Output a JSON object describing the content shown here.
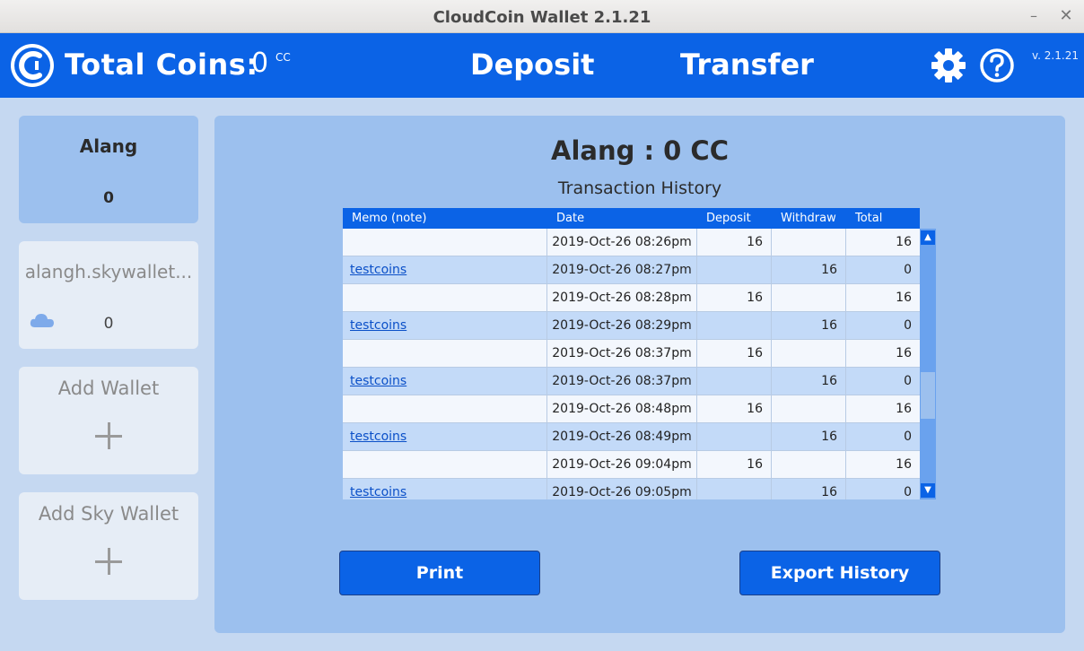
{
  "window": {
    "title": "CloudCoin Wallet 2.1.21",
    "minimize": "–",
    "close": "✕"
  },
  "header": {
    "total_label": "Total Coins:",
    "total_value": "0",
    "total_unit": "CC",
    "deposit": "Deposit",
    "transfer": "Transfer",
    "version": "v. 2.1.21"
  },
  "sidebar": {
    "wallet": {
      "name": "Alang",
      "amount": "0"
    },
    "sky_wallet": {
      "name": "alangh.skywallet...",
      "amount": "0"
    },
    "add_wallet": {
      "label": "Add Wallet"
    },
    "add_sky_wallet": {
      "label": "Add Sky Wallet"
    }
  },
  "main": {
    "title": "Alang : 0 CC",
    "subtitle": "Transaction History",
    "columns": [
      "Memo (note)",
      "Date",
      "Deposit",
      "Withdraw",
      "Total"
    ],
    "rows": [
      {
        "memo": "",
        "date": "2019-Oct-26 08:26pm",
        "deposit": "16",
        "withdraw": "",
        "total": "16"
      },
      {
        "memo": "testcoins",
        "date": "2019-Oct-26 08:27pm",
        "deposit": "",
        "withdraw": "16",
        "total": "0"
      },
      {
        "memo": "",
        "date": "2019-Oct-26 08:28pm",
        "deposit": "16",
        "withdraw": "",
        "total": "16"
      },
      {
        "memo": "testcoins",
        "date": "2019-Oct-26 08:29pm",
        "deposit": "",
        "withdraw": "16",
        "total": "0"
      },
      {
        "memo": "",
        "date": "2019-Oct-26 08:37pm",
        "deposit": "16",
        "withdraw": "",
        "total": "16"
      },
      {
        "memo": "testcoins",
        "date": "2019-Oct-26 08:37pm",
        "deposit": "",
        "withdraw": "16",
        "total": "0"
      },
      {
        "memo": "",
        "date": "2019-Oct-26 08:48pm",
        "deposit": "16",
        "withdraw": "",
        "total": "16"
      },
      {
        "memo": "testcoins",
        "date": "2019-Oct-26 08:49pm",
        "deposit": "",
        "withdraw": "16",
        "total": "0"
      },
      {
        "memo": "",
        "date": "2019-Oct-26 09:04pm",
        "deposit": "16",
        "withdraw": "",
        "total": "16"
      },
      {
        "memo": "testcoins",
        "date": "2019-Oct-26 09:05pm",
        "deposit": "",
        "withdraw": "16",
        "total": "0"
      }
    ],
    "print_label": "Print",
    "export_label": "Export History"
  },
  "icons": {
    "logo": "cloudcoin-logo-icon",
    "settings": "gear-icon",
    "help": "help-icon",
    "cloud": "cloud-icon",
    "add": "plus-icon",
    "scroll_up": "arrow-up-icon",
    "scroll_down": "arrow-down-icon"
  },
  "colors": {
    "brand_blue": "#0b63e6",
    "panel_blue": "#9cc0ee",
    "background": "#c5d8f1"
  }
}
